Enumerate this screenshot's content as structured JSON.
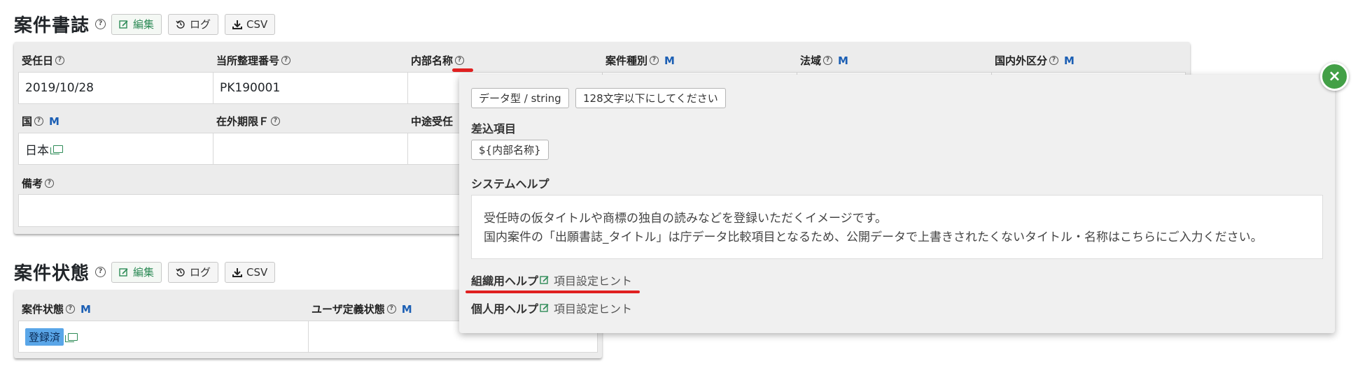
{
  "section1": {
    "title": "案件書誌",
    "edit_label": "編集",
    "log_label": "ログ",
    "csv_label": "CSV",
    "fields_row1": [
      {
        "label": "受任日",
        "value": "2019/10/28"
      },
      {
        "label": "当所整理番号",
        "value": "PK190001"
      },
      {
        "label": "内部名称"
      },
      {
        "label": "案件種別",
        "m": "M"
      },
      {
        "label": "法域",
        "m": "M"
      },
      {
        "label": "国内外区分",
        "m": "M"
      }
    ],
    "fields_row2": [
      {
        "label": "国",
        "m": "M",
        "value": "日本"
      },
      {
        "label": "在外期限Ｆ",
        "value": ""
      },
      {
        "label": "中途受任"
      }
    ],
    "remarks_label": "備考"
  },
  "section2": {
    "title": "案件状態",
    "edit_label": "編集",
    "log_label": "ログ",
    "csv_label": "CSV",
    "status_label": "案件状態",
    "status_m": "M",
    "status_value": "登録済",
    "user_status_label": "ユーザ定義状態",
    "user_status_m": "M"
  },
  "popover": {
    "datatype_tag": "データ型 / string",
    "length_tag": "128文字以下にしてください",
    "insert_label": "差込項目",
    "insert_tag": "${内部名称}",
    "system_help_label": "システムヘルプ",
    "help_line1": "受任時の仮タイトルや商標の独自の読みなどを登録いただくイメージです。",
    "help_line2": "国内案件の「出願書誌_タイトル」は庁データ比較項目となるため、公開データで上書きされたくないタイトル・名称はこちらにご入力ください。",
    "org_help_label": "組織用ヘルプ",
    "org_help_hint": "項目設定ヒント",
    "personal_help_label": "個人用ヘルプ",
    "personal_help_hint": "項目設定ヒント",
    "close_symbol": "×"
  },
  "icons": {
    "question": "?",
    "edit": "edit-icon",
    "log": "history-icon",
    "csv": "download-icon",
    "copy": "copy-icon"
  },
  "colors": {
    "accent_green": "#43a047",
    "link_blue": "#1c5fb4",
    "badge_blue": "#5aa6e8",
    "annotation_red": "#e02020"
  }
}
